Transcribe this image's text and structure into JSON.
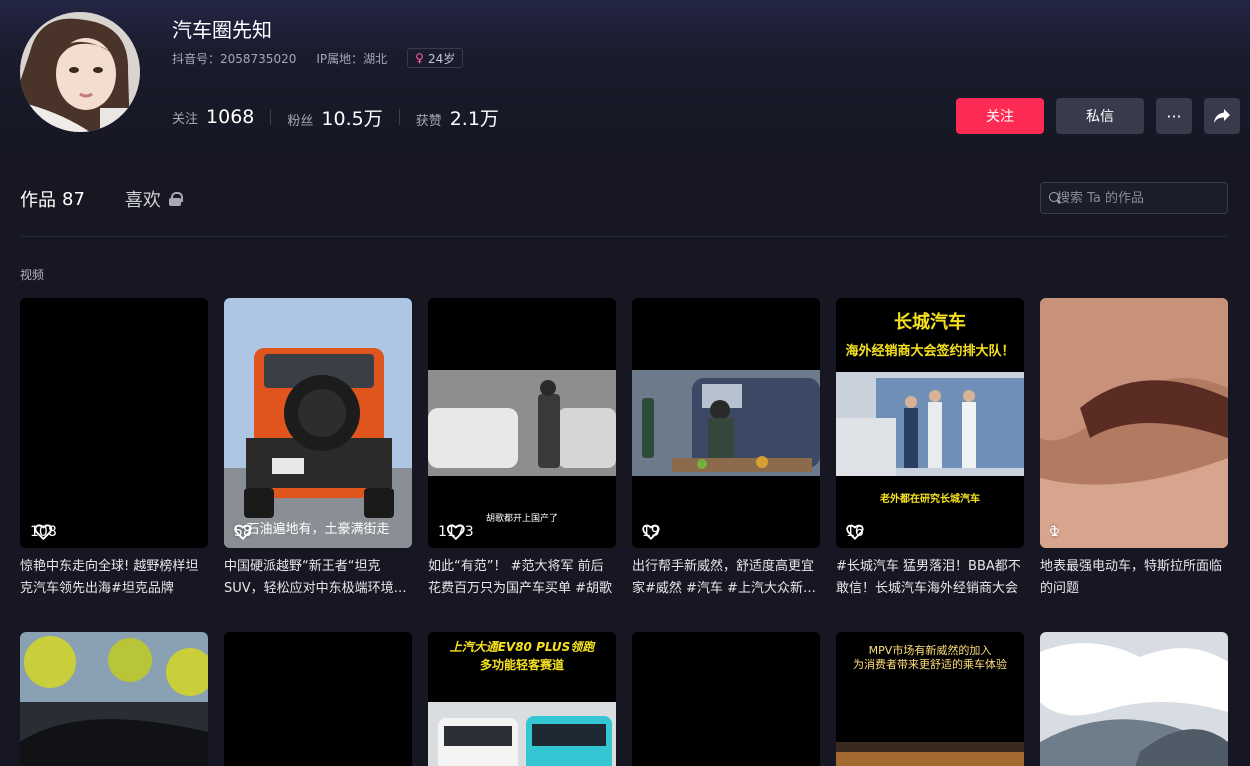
{
  "profile": {
    "name": "汽车圈先知",
    "douyin_id": "抖音号：2058735020",
    "ip_location": "IP属地：湖北",
    "age": "24岁",
    "stats": {
      "following_label": "关注",
      "following_value": "1068",
      "followers_label": "粉丝",
      "followers_value": "10.5万",
      "likes_label": "获赞",
      "likes_value": "2.1万"
    },
    "actions": {
      "follow": "关注",
      "message": "私信",
      "more": "···",
      "share": "➦"
    }
  },
  "tabs": {
    "works_label": "作品",
    "works_count": "87",
    "likes_label": "喜欢"
  },
  "search": {
    "placeholder": "搜索 Ta 的作品"
  },
  "section_label": "视频",
  "videos_row1": [
    {
      "likes": "108",
      "title": "惊艳中东走向全球! 越野榜样坦克汽车领先出海#坦克品牌"
    },
    {
      "likes": "58",
      "overlay": "石油遍地有，土豪满街走",
      "title": "中国硬派越野“新王者“坦克SUV，轻松应对中东极端环境挑战"
    },
    {
      "likes": "1173",
      "overlay": "胡歌都开上国产了",
      "title": "如此“有范”！ #范大将军 前后花费百万只为国产车买单 #胡歌"
    },
    {
      "likes": "19",
      "title": "出行帮手新威然，舒适度高更宜家#威然 #汽车 #上汽大众新威然"
    },
    {
      "likes": "16",
      "overlay_top": "长城汽车",
      "overlay_sub": "海外经销商大会签约排大队！",
      "overlay": "老外都在研究长城汽车",
      "title": "#长城汽车 猛男落泪！BBA都不敢信！长城汽车海外经销商大会"
    },
    {
      "likes": "1",
      "title": "地表最强电动车，特斯拉所面临的问题"
    }
  ],
  "videos_row2": [
    {
      "label": ""
    },
    {
      "label": ""
    },
    {
      "overlay_top": "上汽大通EV80 PLUS领跑",
      "overlay_sub": "多功能轻客赛道"
    },
    {
      "label": ""
    },
    {
      "overlay_top": "MPV市场有新威然的加入",
      "overlay_sub": "为消费者带来更舒适的乘车体验"
    },
    {
      "label": ""
    }
  ],
  "colors": {
    "accent": "#fe2c55",
    "background": "#161722",
    "button_secondary": "#393a4b",
    "highlight_yellow": "#f5e11f"
  }
}
